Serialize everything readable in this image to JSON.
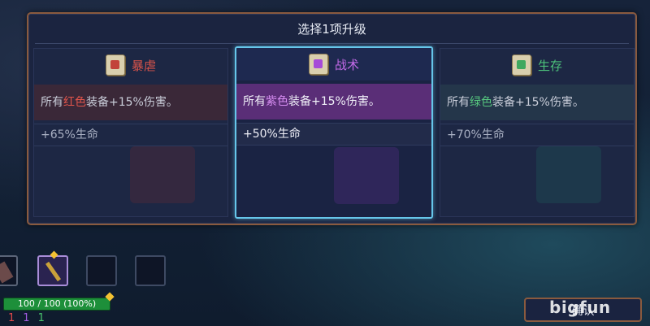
{
  "dialog": {
    "title": "选择1项升级"
  },
  "cards": [
    {
      "name": "暴虐",
      "color": "#d9534a",
      "desc_prefix": "所有",
      "desc_highlight": "红色",
      "desc_suffix": "装备+15%伤害。",
      "stat": "+65%生命",
      "icon": "fist-icon",
      "selected": false
    },
    {
      "name": "战术",
      "color": "#c46ae8",
      "desc_prefix": "所有",
      "desc_highlight": "紫色",
      "desc_suffix": "装备+15%伤害。",
      "stat": "+50%生命",
      "icon": "lightning-icon",
      "selected": true
    },
    {
      "name": "生存",
      "color": "#4cc07a",
      "desc_prefix": "所有",
      "desc_highlight": "绿色",
      "desc_suffix": "装备+15%伤害。",
      "stat": "+70%生命",
      "icon": "cross-icon",
      "selected": false
    }
  ],
  "player": {
    "hp_text": "100 / 100 (100%)",
    "hp_fraction": 1.0,
    "counts": [
      "1",
      "1",
      "1"
    ]
  },
  "confirm_label": "确认",
  "watermark": "bigfun"
}
